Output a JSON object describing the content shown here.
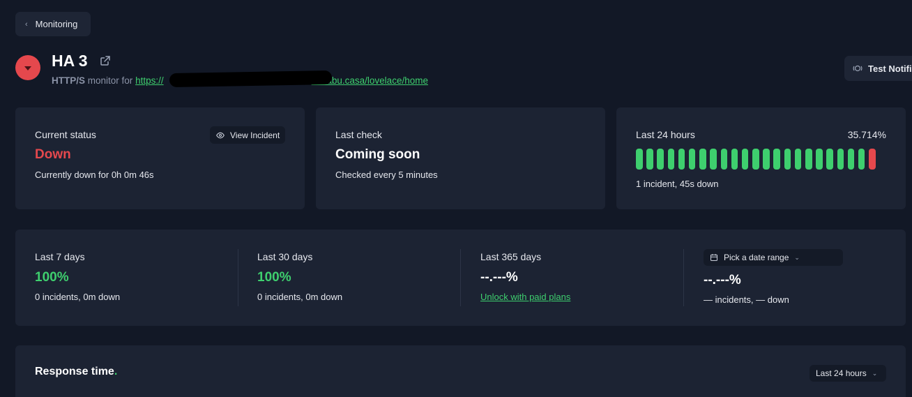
{
  "nav": {
    "back_label": "Monitoring"
  },
  "monitor": {
    "name": "HA 3",
    "protocol": "HTTP/S",
    "monitor_for": "monitor for",
    "url_start": "https://",
    "url_end": "ui.nabu.casa/lovelace/home"
  },
  "actions": {
    "test_notifications": "Test Notifications"
  },
  "current_status": {
    "label": "Current status",
    "value": "Down",
    "detail": "Currently down for 0h 0m 46s",
    "view_incident": "View Incident"
  },
  "last_check": {
    "label": "Last check",
    "value": "Coming soon",
    "detail": "Checked every 5 minutes"
  },
  "last_24h": {
    "label": "Last 24 hours",
    "percent": "35.714%",
    "detail": "1 incident, 45s down",
    "bars": [
      "up",
      "up",
      "up",
      "up",
      "up",
      "up",
      "up",
      "up",
      "up",
      "up",
      "up",
      "up",
      "up",
      "up",
      "up",
      "up",
      "up",
      "up",
      "up",
      "up",
      "up",
      "up",
      "down"
    ]
  },
  "availability": {
    "last_7": {
      "label": "Last 7 days",
      "value": "100%",
      "detail": "0 incidents, 0m down"
    },
    "last_30": {
      "label": "Last 30 days",
      "value": "100%",
      "detail": "0 incidents, 0m down"
    },
    "last_365": {
      "label": "Last 365 days",
      "value": "--.---%",
      "detail": "Unlock with paid plans"
    },
    "custom": {
      "picker": "Pick a date range",
      "value": "--.---%",
      "detail": "— incidents, — down"
    }
  },
  "response_time": {
    "title": "Response time",
    "dot": ".",
    "range": "Last 24 hours"
  },
  "colors": {
    "bg": "#121826",
    "card": "#1c2333",
    "up": "#3ecf6e",
    "down": "#e5484d"
  }
}
